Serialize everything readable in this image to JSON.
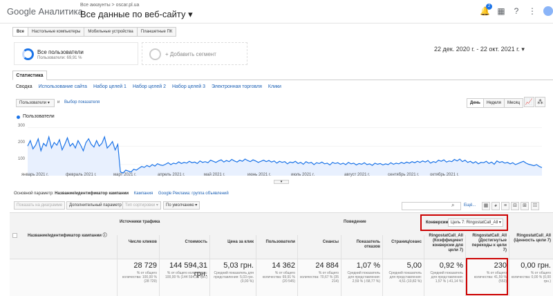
{
  "header": {
    "logo": "Google Аналитика",
    "breadcrumb": "Все аккаунты > oscar.pl.ua",
    "view_title": "Все данные по веб-сайту",
    "notif_count": "2"
  },
  "device_tabs": [
    "Все",
    "Настольные компьютеры",
    "Мобильные устройства",
    "Планшетные ПК"
  ],
  "segment": {
    "name": "Все пользователи",
    "sub": "Пользователи: 69,91 %",
    "add_label": "+ Добавить сегмент"
  },
  "date_range": "22 дек. 2020 г. - 22 окт. 2021 г.",
  "stat_tab": "Статистика",
  "explorer_tabs": [
    "Сводка",
    "Использование сайта",
    "Набор целей 1",
    "Набор целей 2",
    "Набор целей 3",
    "Электронная торговля",
    "Клики"
  ],
  "metric": {
    "selected": "Пользователи",
    "vs": "и",
    "pick": "Выбор показателя"
  },
  "granularity": [
    "День",
    "Неделя",
    "Месяц"
  ],
  "legend_label": "Пользователи",
  "chart_data": {
    "type": "line",
    "series": [
      {
        "name": "Пользователи"
      }
    ],
    "yticks": [
      "300",
      "200",
      "100"
    ],
    "ylim": [
      40,
      310
    ],
    "xticks": [
      "январь 2021 г.",
      "февраль 2021 г.",
      "март 2021 г.",
      "апрель 2021 г.",
      "май 2021 г.",
      "июнь 2021 г.",
      "июль 2021 г.",
      "август 2021 г.",
      "сентябрь 2021 г.",
      "октябрь 2021 г."
    ],
    "values": [
      200,
      230,
      185,
      205,
      240,
      175,
      215,
      200,
      250,
      190,
      220,
      205,
      235,
      180,
      210,
      245,
      200,
      215,
      190,
      230,
      205,
      175,
      220,
      240,
      210,
      195,
      230,
      200,
      215,
      250,
      190,
      205,
      225,
      180,
      210,
      60,
      55,
      70,
      65,
      60,
      75,
      70,
      80,
      90,
      85,
      95,
      88,
      100,
      92,
      105,
      98,
      95,
      102,
      110,
      100,
      108,
      104,
      115,
      106,
      112,
      108,
      118,
      110,
      114,
      106,
      120,
      112,
      116,
      110,
      124,
      118,
      112,
      120,
      126,
      114,
      122,
      116,
      128,
      120,
      114,
      124,
      118,
      130,
      122,
      116,
      126,
      120,
      112,
      118,
      124,
      116,
      122,
      114,
      120,
      108,
      118,
      112,
      116,
      104,
      114,
      110,
      118,
      106,
      112,
      102,
      116,
      108,
      112,
      100,
      110,
      106,
      114,
      104,
      108,
      98,
      112,
      106,
      110,
      102,
      108,
      100,
      112,
      104,
      108,
      98,
      106,
      102,
      110,
      100,
      104,
      96,
      108,
      102,
      106,
      98,
      104,
      100,
      110,
      102,
      108,
      104,
      112,
      106,
      114,
      108,
      116,
      110,
      118,
      112,
      120,
      114,
      122,
      108,
      116,
      112,
      124,
      118,
      126,
      114,
      120,
      116,
      128,
      120,
      130,
      116,
      124,
      112,
      118,
      108,
      116,
      104,
      112,
      110,
      118,
      106,
      114,
      102,
      120,
      112,
      116,
      108,
      112,
      104,
      110,
      100,
      106,
      112,
      118,
      108,
      102,
      98,
      94,
      100,
      90,
      84
    ],
    "grid": true
  },
  "primary_dim": {
    "label": "Основной параметр:",
    "selected": "Название/идентификатор кампании",
    "alt1": "Кампания",
    "alt2": "Google Реклама: группа объявлений"
  },
  "toolbar": {
    "plot_rows": "Показать на диаграмме",
    "secondary": "Дополнительный параметр",
    "sort": "Тип сортировки",
    "default": "По умолчанию",
    "more": "Ещё..."
  },
  "table": {
    "group_traffic": "Источники трафика",
    "group_behavior": "Поведение",
    "conv_label": "Конверсии",
    "conv_goal": "Цель 7: RingostatCall_All",
    "dim_header": "Название/идентификатор кампании",
    "columns": [
      {
        "h": "Число кликов",
        "v": "28 729",
        "s": "% от общего количества: 100,00 % (28 729)"
      },
      {
        "h": "Стоимость",
        "v": "144 594,31 грн.",
        "s": "% от общего количества: 100,00 % (144 594,31 грн.)"
      },
      {
        "h": "Цена за клик",
        "v": "5,03 грн.",
        "s": "Средний показатель для представления: 5,03 грн. (0,00 %)"
      },
      {
        "h": "Пользователи",
        "v": "14 362",
        "s": "% от общего количества: 69,91 % (20 545)"
      },
      {
        "h": "Сеансы",
        "v": "24 884",
        "s": "% от общего количества: 70,67 % (35 214)"
      },
      {
        "h": "Показатель отказов",
        "v": "1,07 %",
        "s": "Средний показатель для представления: 2,59 % (-58,77 %)"
      },
      {
        "h": "Страниц/сеанс",
        "v": "5,00",
        "s": "Средний показатель для представления: 4,51 (10,82 %)"
      },
      {
        "h": "RingostatCall_All (Коэффициент конверсии для цели 7)",
        "v": "0,92 %",
        "s": "Средний показатель для представления: 1,57 % (-41,14 %)"
      },
      {
        "h": "RingostatCall_All (Достигнутые переходы к цели 7)",
        "v": "230",
        "s": "% от общего количества: 41,59 % (553)"
      },
      {
        "h": "RingostatCall_All (Ценность цели 7)",
        "v": "0,00 грн.",
        "s": "% от общего количества: 0,00 % (0,00 грн.)"
      }
    ]
  }
}
